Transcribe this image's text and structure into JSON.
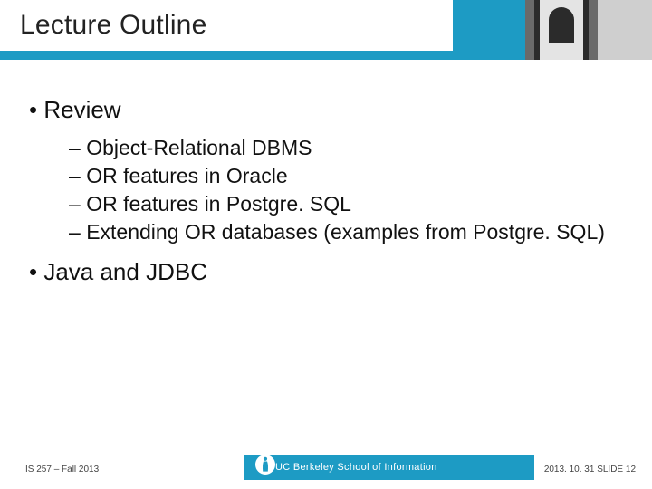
{
  "title": "Lecture Outline",
  "bullets": {
    "item1": {
      "label": "Review"
    },
    "sub": {
      "a": "Object-Relational DBMS",
      "b": "OR features in Oracle",
      "c": "OR features in Postgre. SQL",
      "d": "Extending OR databases (examples from Postgre. SQL)"
    },
    "item2": {
      "label": "Java and JDBC"
    }
  },
  "footer": {
    "left": "IS 257 – Fall 2013",
    "center": "UC Berkeley School of Information",
    "right": "2013. 10. 31 SLIDE 12"
  }
}
